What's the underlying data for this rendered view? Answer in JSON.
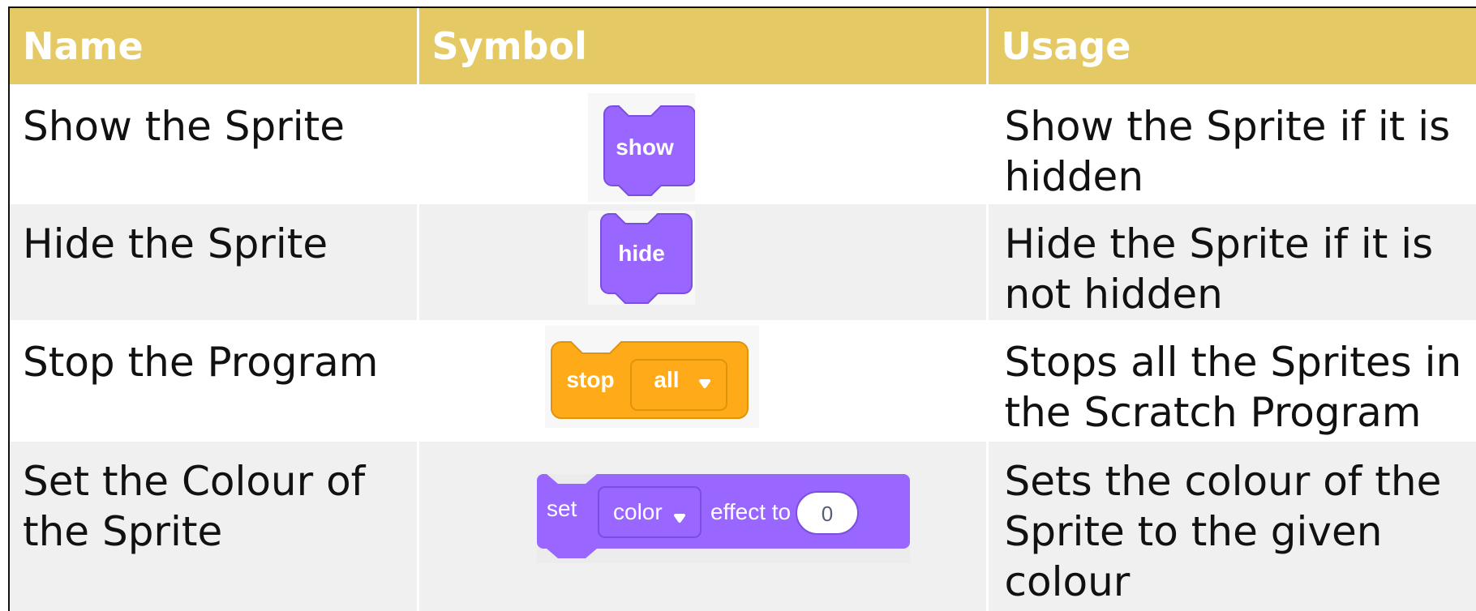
{
  "header": {
    "name": "Name",
    "symbol": "Symbol",
    "usage": "Usage"
  },
  "rows": [
    {
      "name": "Show the Sprite",
      "block": {
        "word": "show"
      },
      "usage": "Show the Sprite if it is hidden"
    },
    {
      "name": "Hide the Sprite",
      "block": {
        "word": "hide"
      },
      "usage": "Hide the Sprite if it is not hidden"
    },
    {
      "name": "Stop the Program",
      "block": {
        "word": "stop",
        "dropdown": "all"
      },
      "usage": "Stops all the Sprites in the Scratch Program"
    },
    {
      "name": "Set the Colour of the Sprite",
      "block": {
        "word": "set",
        "dropdown": "color",
        "suffix": "effect to",
        "input": "0"
      },
      "usage": "Sets the colour of the Sprite to the given colour"
    }
  ],
  "colors": {
    "header": "#e4c964",
    "looks": "#9966ff",
    "control": "#ffab19",
    "stripe": "#f0f0f0"
  }
}
